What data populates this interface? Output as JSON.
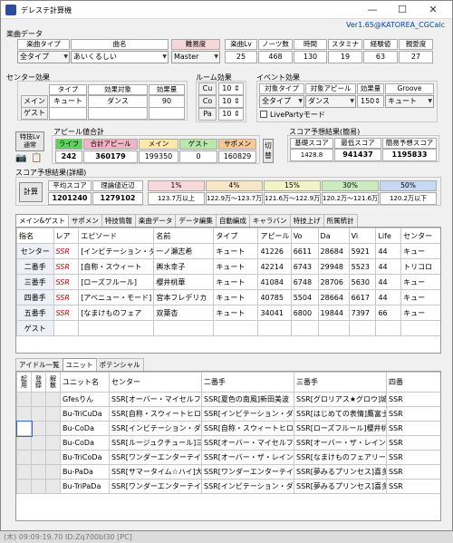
{
  "window": {
    "title": "デレステ計算機",
    "minimize": "—",
    "maximize": "☐",
    "close": "✕",
    "version": "Ver1.65@KATOREA_CGCalc"
  },
  "music": {
    "section": "楽曲データ",
    "headers": {
      "type": "楽曲タイプ",
      "name": "曲名",
      "difficulty": "難易度",
      "level": "楽曲Lv",
      "notes": "ノーツ数",
      "time": "時間",
      "stamina": "スタミナ",
      "exp": "経験値",
      "affection": "親愛度"
    },
    "values": {
      "type": "全タイプ",
      "name": "あいくるしい",
      "difficulty": "Master",
      "level": "25",
      "notes": "468",
      "time": "130",
      "stamina": "19",
      "exp": "63",
      "affection": "27"
    }
  },
  "center": {
    "section": "センター効果",
    "headers": {
      "type": "タイプ",
      "target": "効果対象",
      "amount": "効果量"
    },
    "main_label": "メイン",
    "guest_label": "ゲスト",
    "main": {
      "type": "キュート",
      "target": "ダンス",
      "amount": "90"
    },
    "guest": {
      "type": "",
      "target": "",
      "amount": ""
    }
  },
  "room": {
    "section": "ルーム効果",
    "items": [
      {
        "label": "Cu",
        "value": "10"
      },
      {
        "label": "Co",
        "value": "10"
      },
      {
        "label": "Pa",
        "value": "10"
      }
    ]
  },
  "event": {
    "section": "イベント効果",
    "headers": {
      "type": "対象タイプ",
      "appeal": "対象アピール",
      "amount": "効果量",
      "groove": "Groove"
    },
    "values": {
      "type": "全タイプ",
      "appeal": "ダンス",
      "amount": "150",
      "groove": "キュート"
    },
    "liveparty": "LivePartyモード"
  },
  "appeal": {
    "section": "アピール値合計",
    "special_btn": "特技Lv\n通常",
    "headers": [
      "ライフ",
      "合計アピール",
      "メイン",
      "ゲスト",
      "サポメン"
    ],
    "values": [
      "242",
      "360179",
      "199350",
      "0",
      "160829"
    ],
    "switch_btn": "切替",
    "camera_icon": "camera-icon",
    "copy_icon": "clipboard-icon"
  },
  "simple": {
    "section": "スコア予想結果(簡易)",
    "headers": [
      "基礎スコア",
      "最低スコア",
      "簡易予想スコア"
    ],
    "values": [
      "1428.8",
      "941437",
      "1195833"
    ]
  },
  "detail": {
    "section": "スコア予想結果(詳細)",
    "calc_btn": "計算",
    "headers": [
      "平均スコア",
      "理論値近辺"
    ],
    "values": [
      "1201240",
      "1279102"
    ],
    "buckets": [
      {
        "pct": "1%",
        "range": "123.7万以上",
        "color": "#f7d9d9"
      },
      {
        "pct": "4%",
        "range": "122.9万〜123.7万",
        "color": "#f8e6c8"
      },
      {
        "pct": "15%",
        "range": "121.6万〜122.9万",
        "color": "#f3f3c8"
      },
      {
        "pct": "30%",
        "range": "120.2万〜121.6万",
        "color": "#cdebc0"
      },
      {
        "pct": "50%",
        "range": "120.2万以下",
        "color": "#c8d8f0"
      }
    ]
  },
  "main_tabs": [
    "メイン&ゲスト",
    "サポメン",
    "特技情報",
    "楽曲データ",
    "データ編集",
    "自動編成",
    "キャラバン",
    "特技上げ",
    "所属統計"
  ],
  "members": {
    "columns": [
      "指名",
      "レア",
      "エピソード",
      "名前",
      "タイプ",
      "アピール",
      "Vo",
      "Da",
      "Vi",
      "Life",
      "センター"
    ],
    "rows": [
      [
        "センター",
        "SSR",
        "[インビテーション・ダ",
        "一ノ瀬志希",
        "キュート",
        "41226",
        "6611",
        "28684",
        "5921",
        "44",
        "キュー"
      ],
      [
        "二番手",
        "SSR",
        "[自称・スウィート",
        "輿水幸子",
        "キュート",
        "42214",
        "6743",
        "29948",
        "5523",
        "44",
        "トリコロ"
      ],
      [
        "三番手",
        "SSR",
        "[ローズフルール]",
        "櫻井桃華",
        "キュート",
        "41084",
        "6748",
        "28706",
        "5630",
        "44",
        "キュー"
      ],
      [
        "四番手",
        "SSR",
        "[アベニュー・モード]",
        "宮本フレデリカ",
        "キュート",
        "40785",
        "5504",
        "28664",
        "6617",
        "44",
        "キュー"
      ],
      [
        "五番手",
        "SSR",
        "[なまけものフェア",
        "双葉杏",
        "キュート",
        "34041",
        "6800",
        "19844",
        "7397",
        "66",
        "キュー"
      ],
      [
        "ゲスト",
        "",
        "",
        "",
        "",
        "",
        "",
        "",
        "",
        "",
        ""
      ]
    ]
  },
  "lower_tabs": [
    "アイドル一覧",
    "ユニット",
    "ポテンシャル"
  ],
  "units": {
    "columns": [
      "起用",
      "登録",
      "解散",
      "ユニット名",
      "センター",
      "二番手",
      "三番手",
      "四番"
    ],
    "rows": [
      [
        "Gfesりん",
        "SSR[オーバー・マイセルフ]渋...",
        "SSR[夏色の南風]新田美波",
        "SSR[グロリアス★グロウ]城ケ...",
        "SSR"
      ],
      [
        "Bu-TriCuDa",
        "SSR[自称・スウィートヒロイン]...",
        "SSR[インビテーション・ダイブ]...",
        "SSR[はじめての表情]鷹富士茄...",
        "SSR"
      ],
      [
        "Bu-CoDa",
        "SSR[インビテーション・ダイブ]...",
        "SSR[自称・スウィートヒロイン]...",
        "SSR[ローズフルール]櫻井桃華",
        "SSR"
      ],
      [
        "Bu-CoDa",
        "SSR[ルージュクチュール]三船...",
        "SSR[オーバー・マイセルフ]渋...",
        "SSR[オーバー・ザ・レインボー]...",
        "SSR"
      ],
      [
        "Bu-TriCoDa",
        "SSR[ワンダーエンターテイナー...",
        "SSR[オーバー・ザ・レインボー]...",
        "SSR[なまけものフェアリー]双葉...",
        "SSR"
      ],
      [
        "Bu-PaDa",
        "SSR[サマータイム☆ハイ]大槻...",
        "SSR[ワンダーエンターテイナー]...",
        "SSR[夢みるプリンセス]喜多...",
        "SSR"
      ],
      [
        "Bu-TriPaDa",
        "SSR[ワンダーエンターテイナー...",
        "SSR[インビテーション・ダイブ]...",
        "SSR[夢みるプリンセス]喜多...",
        "SSR"
      ]
    ]
  },
  "taskbar": {
    "text": "(木) 09:09:19.70 ID:Zq700bI30 [PC]"
  }
}
